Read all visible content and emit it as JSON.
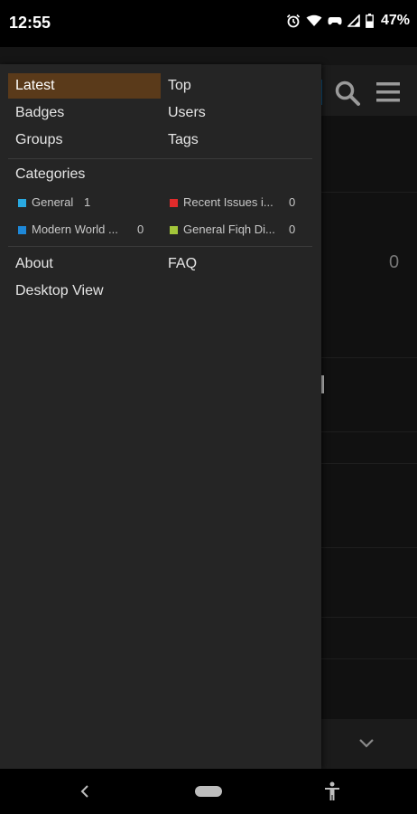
{
  "status_bar": {
    "time": "12:55",
    "battery": "47%",
    "icons": [
      "alarm-icon",
      "wifi-icon",
      "game-controller-icon",
      "signal-icon",
      "battery-icon"
    ]
  },
  "background_app": {
    "stat_value": "0",
    "header_icons": [
      "search-icon",
      "menu-icon"
    ],
    "footer_icon": "chevron-down-icon"
  },
  "drawer": {
    "nav_left": [
      "Latest",
      "Badges",
      "Groups"
    ],
    "nav_right": [
      "Top",
      "Users",
      "Tags"
    ],
    "active_item": "Latest",
    "categories_heading": "Categories",
    "categories": [
      {
        "name": "General",
        "count": "1",
        "color": "#29a9e1"
      },
      {
        "name": "Recent Issues i...",
        "count": "0",
        "color": "#e02b2b"
      },
      {
        "name": "Modern World ...",
        "count": "0",
        "color": "#1e88d8"
      },
      {
        "name": "General Fiqh Di...",
        "count": "0",
        "color": "#a3c63a"
      }
    ],
    "footer_left": [
      "About",
      "Desktop View"
    ],
    "footer_right": [
      "FAQ"
    ]
  },
  "nav_bar": {
    "icons": [
      "back-icon",
      "home-pill",
      "accessibility-icon"
    ]
  },
  "colors": {
    "active_bg": "#5a3a1a",
    "drawer_bg": "#252525",
    "status_bar_bg": "#000000"
  }
}
